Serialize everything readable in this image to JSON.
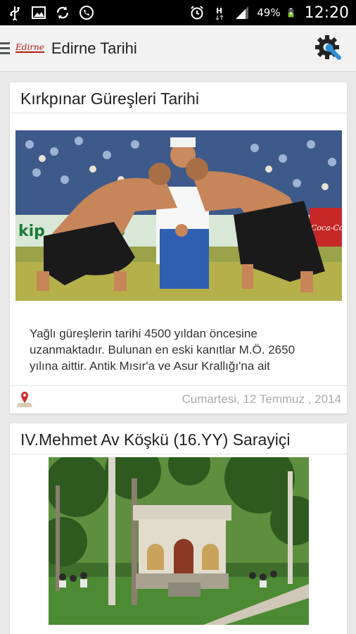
{
  "status_bar": {
    "icons_left": [
      "usb-icon",
      "image-icon",
      "sync-icon",
      "phone-icon"
    ],
    "icons_right": [
      "alarm-icon",
      "network-h-icon",
      "signal-icon",
      "battery-icon"
    ],
    "battery": "49%",
    "time": "12:20"
  },
  "action_bar": {
    "logo": "Edirne",
    "title": "Edirne Tarihi",
    "settings_icon": "settings-wrench-icon"
  },
  "articles": [
    {
      "title": "Kırkpınar Güreşleri Tarihi",
      "image_desc": "oil-wrestling-photo",
      "excerpt_lines": [
        "Yağlı güreşlerin tarihi 4500 yıldan öncesine",
        "uzanmaktadır. Bulunan en eski kanıtlar M.Ö. 2650",
        "yılına aittir. Antik Mısır'a ve Asur Krallığı'na ait"
      ],
      "date": "Cumartesi, 12 Temmuz , 2014",
      "location_icon": "map-pin-icon"
    },
    {
      "title": "IV.Mehmet Av Köşkü (16.YY) Sarayiçi",
      "image_desc": "hunting-pavilion-photo"
    }
  ],
  "colors": {
    "statusbar": "#000000",
    "actionbar": "#f2f2f2",
    "background": "#e9e9e9",
    "date_text": "#a9a9a9",
    "logo_red": "#b31b1b"
  }
}
